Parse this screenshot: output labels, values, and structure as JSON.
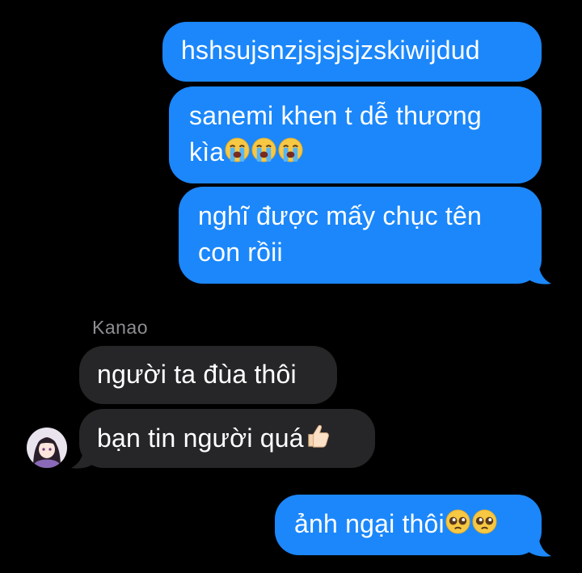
{
  "messages": {
    "out1": "hshsujsnzjsjsjsjzskiwijdud",
    "out2_line1": "sanemi khen t dễ thương",
    "out2_line2": "kìa",
    "out3_line1": "nghĩ được mấy chục tên",
    "out3_line2": "con rồii",
    "sender_name": "Kanao",
    "in1": "người ta đùa thôi",
    "in2": "bạn tin người quá",
    "out4": "ảnh ngại thôi"
  },
  "icons": {
    "crying": "loudly-crying-face-icon",
    "thumbs": "thumbs-up-icon",
    "pleading": "pleading-face-icon"
  },
  "colors": {
    "background": "#000000",
    "outgoing_bubble": "#1b87fb",
    "incoming_bubble": "#262628",
    "sender_name": "#8e8e93"
  }
}
